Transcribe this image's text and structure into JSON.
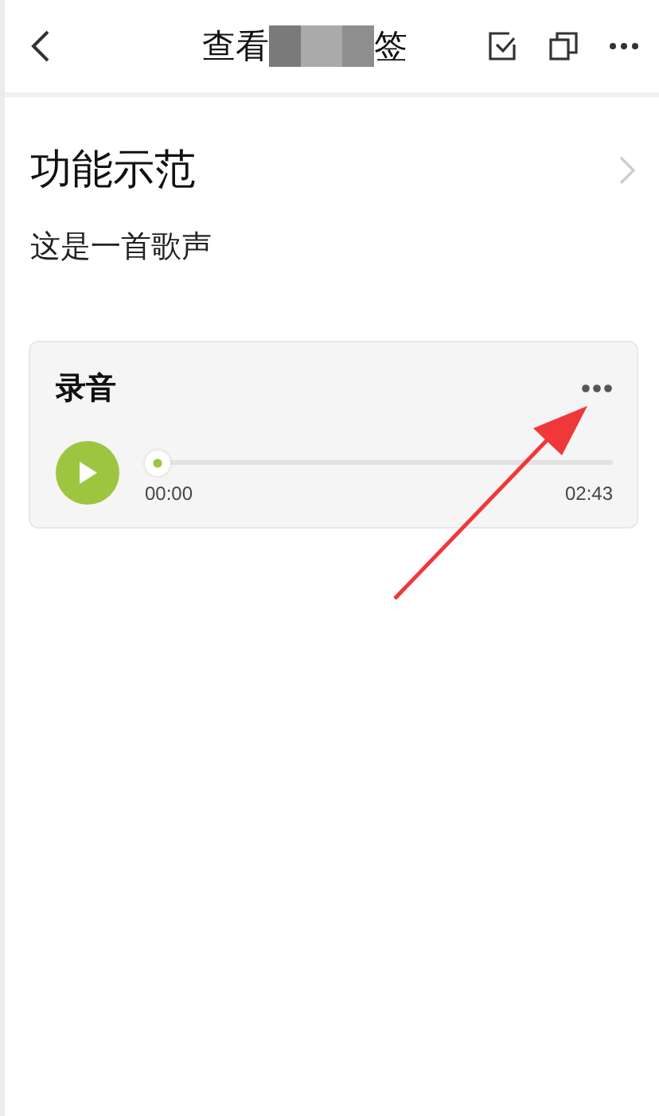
{
  "header": {
    "title_start": "查看",
    "title_end": "签"
  },
  "note": {
    "title": "功能示范",
    "body": "这是一首歌声"
  },
  "recording": {
    "title": "录音",
    "level": 0,
    "elapsed": "00:00",
    "duration": "02:43"
  }
}
